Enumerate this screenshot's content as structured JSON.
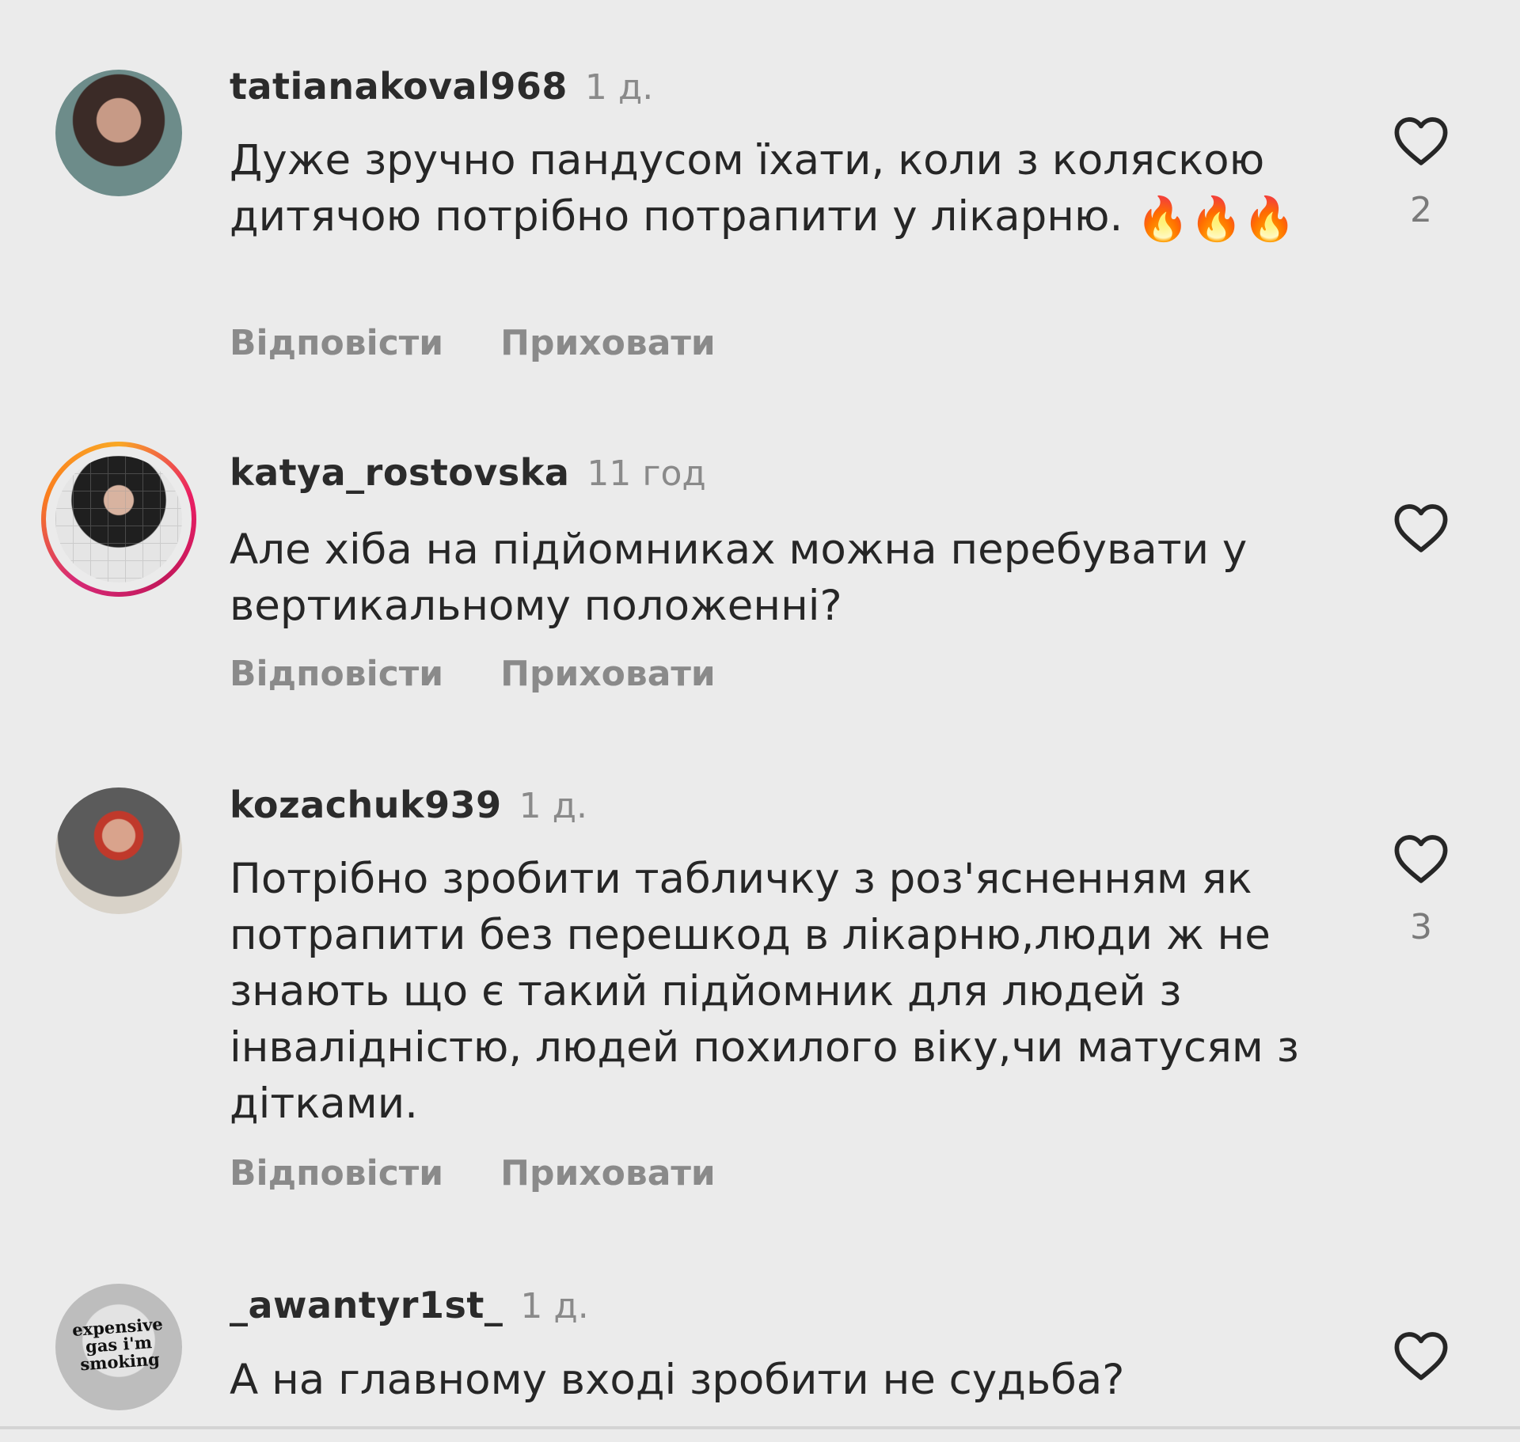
{
  "comments": [
    {
      "username": "tatianakoval968",
      "time": "1 д.",
      "text": "Дуже зручно пандусом їхати, коли з коляскою дитячою потрібно потрапити у лікарню.",
      "emoji": "🔥🔥🔥",
      "like_count": "2",
      "reply_label": "Відповісти",
      "hide_label": "Приховати",
      "avatar": "avatar-photo"
    },
    {
      "username": "katya_rostovska",
      "time": "11 год",
      "text": "Але хіба на підйомниках можна перебувати у вертикальному положенні?",
      "like_count": "",
      "reply_label": "Відповісти",
      "hide_label": "Приховати",
      "avatar": "avatar-photo-story"
    },
    {
      "username": "kozachuk939",
      "time": "1 д.",
      "text": "Потрібно зробити табличку з роз'ясненням як потрапити без перешкод в лікарню,люди ж не знають що є такий підйомник для людей з інвалідністю, людей похилого віку,чи матусям з дітками.",
      "like_count": "3",
      "reply_label": "Відповісти",
      "hide_label": "Приховати",
      "avatar": "avatar-photo"
    },
    {
      "username": "_awantyr1st_",
      "time": "1 д.",
      "text": "А на главному вході зробити не судьба?",
      "like_count": "",
      "avatar": "avatar-text",
      "avatar_text": [
        "expensive",
        "gas i'm",
        "smoking"
      ]
    }
  ],
  "icons": {
    "like": "heart-outline-icon"
  },
  "colors": {
    "background": "#ebebeb",
    "text": "#262626",
    "muted": "#8a8a8a",
    "story_ring_start": "#f9a825",
    "story_ring_end": "#e91e63"
  }
}
